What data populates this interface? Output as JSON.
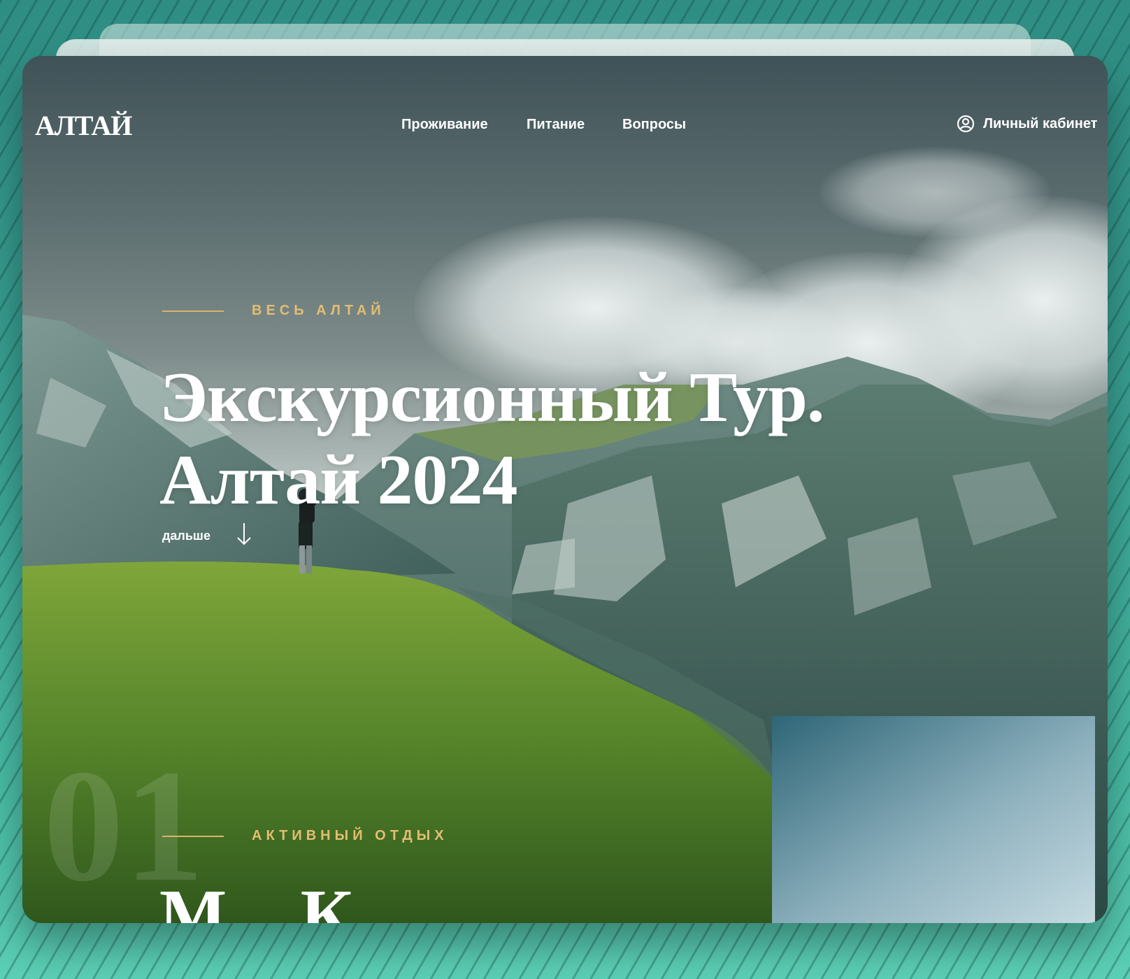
{
  "header": {
    "logo": "АЛТАЙ",
    "nav": [
      {
        "label": "Проживание"
      },
      {
        "label": "Питание"
      },
      {
        "label": "Вопросы"
      }
    ],
    "account_label": "Личный кабинет"
  },
  "hero": {
    "eyebrow": "ВЕСЬ АЛТАЙ",
    "title_line1": "Экскурсионный Тур.",
    "title_line2": "Алтай 2024",
    "more_label": "дальше"
  },
  "next_section": {
    "number": "01",
    "eyebrow": "АКТИВНЫЙ ОТДЫХ",
    "title_partial": "М К"
  },
  "colors": {
    "accent": "#e3bd72",
    "text": "#ffffff",
    "background": "#3aa394"
  },
  "icons": {
    "account": "user-circle-icon",
    "more": "arrow-down-icon"
  }
}
